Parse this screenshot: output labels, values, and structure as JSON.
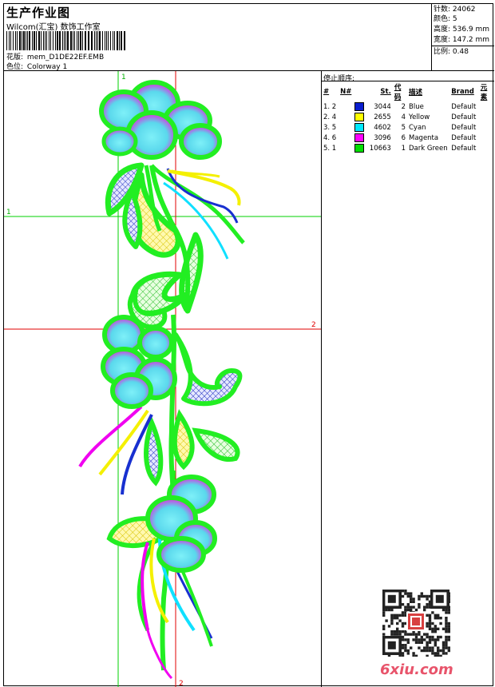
{
  "header": {
    "title": "生产作业图",
    "company": "Wilcom(汇宝) 数饰工作室",
    "design_label": "花版:",
    "design_value": "mem_D1DE22EF.EMB",
    "colorway_label": "色位:",
    "colorway_value": "Colorway 1"
  },
  "stats": {
    "stitches": "针数: 24062",
    "colors": "颜色: 5",
    "height": "高度: 536.9 mm",
    "width": "宽度: 147.2 mm",
    "scale": "比例: 0.48"
  },
  "guides": {
    "v1": "1",
    "h1": "1",
    "h2": "2",
    "v2": "2"
  },
  "sequence": {
    "title": "停止顺序:",
    "headers": [
      "#",
      "N#",
      "",
      "St.",
      "代码",
      "描述",
      "Brand",
      "元素"
    ],
    "rows": [
      {
        "idx": "1. 2",
        "color": "#0a1ecf",
        "st": "3044",
        "code": "2",
        "desc": "Blue",
        "brand": "Default"
      },
      {
        "idx": "2. 4",
        "color": "#ffff00",
        "st": "2655",
        "code": "4",
        "desc": "Yellow",
        "brand": "Default"
      },
      {
        "idx": "3. 5",
        "color": "#00e8ff",
        "st": "4602",
        "code": "5",
        "desc": "Cyan",
        "brand": "Default"
      },
      {
        "idx": "4. 6",
        "color": "#ff00ff",
        "st": "3096",
        "code": "6",
        "desc": "Magenta",
        "brand": "Default"
      },
      {
        "idx": "5. 1",
        "color": "#00e000",
        "st": "10663",
        "code": "1",
        "desc": "Dark Green",
        "brand": "Default"
      }
    ]
  },
  "watermark": {
    "logo": "6xiu.com"
  }
}
